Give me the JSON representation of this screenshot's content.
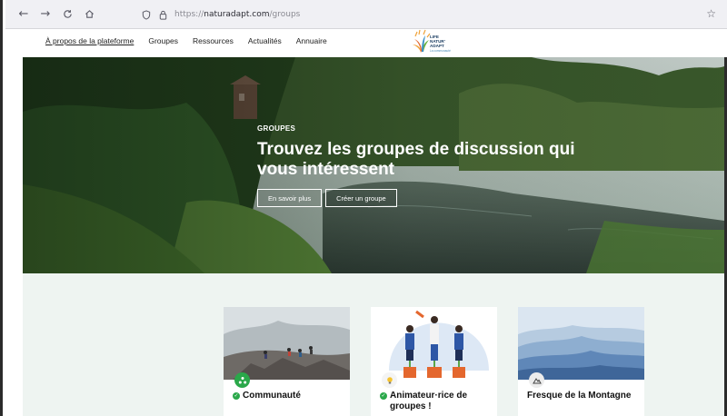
{
  "browser": {
    "url_scheme": "https://",
    "url_host": "naturadapt.com",
    "url_path": "/groups",
    "back_icon": "arrow-left-icon",
    "forward_icon": "arrow-right-icon",
    "reload_icon": "reload-icon",
    "home_icon": "home-icon"
  },
  "nav": {
    "items": [
      {
        "label": "À propos de la plateforme",
        "active": true
      },
      {
        "label": "Groupes",
        "active": false
      },
      {
        "label": "Ressources",
        "active": false
      },
      {
        "label": "Actualités",
        "active": false
      },
      {
        "label": "Annuaire",
        "active": false
      }
    ],
    "logo": {
      "line1": "LIFE",
      "line2": "NATUR'",
      "line3": "ADAPT",
      "sub": "La communauté"
    }
  },
  "hero": {
    "eyebrow": "GROUPES",
    "title": "Trouvez les groupes de discussion qui vous intéressent",
    "button_more": "En savoir plus",
    "button_create": "Créer un groupe"
  },
  "cards": [
    {
      "title": "Communauté",
      "verified": true,
      "badge_color": "#2aa84a"
    },
    {
      "title": "Animateur·rice de groupes !",
      "verified": true,
      "badge_color": "#f4f4f4"
    },
    {
      "title": "Fresque de la Montagne",
      "verified": false,
      "badge_color": "#ececec"
    }
  ],
  "colors": {
    "accent_green": "#2aa84a",
    "section_bg": "#eef4f1"
  }
}
